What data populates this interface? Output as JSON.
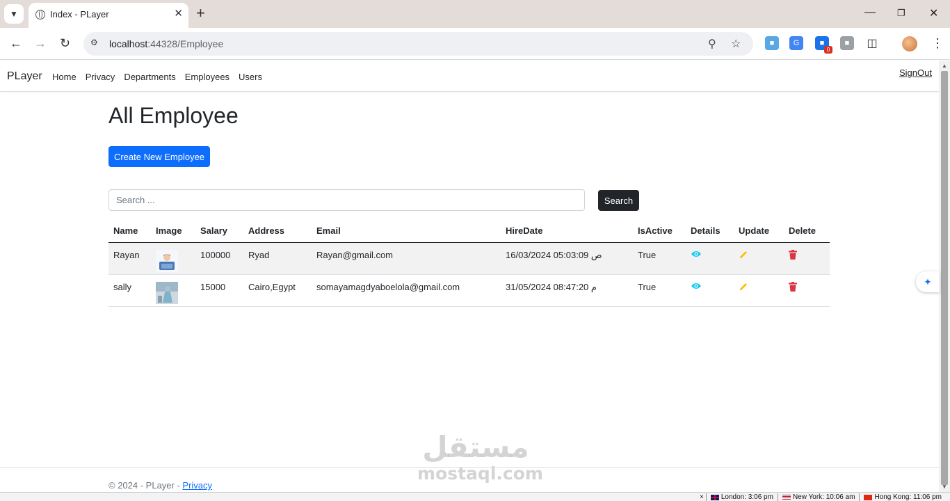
{
  "browser": {
    "tab_title": "Index - PLayer",
    "url_host": "localhost",
    "url_path": ":44328/Employee",
    "extension_badge": "0"
  },
  "navbar": {
    "brand": "PLayer",
    "links": [
      "Home",
      "Privacy",
      "Departments",
      "Employees",
      "Users"
    ],
    "signout": "SignOut"
  },
  "page": {
    "title": "All Employee",
    "create_button": "Create New Employee",
    "search_placeholder": "Search ...",
    "search_button": "Search"
  },
  "table": {
    "headers": [
      "Name",
      "Image",
      "Salary",
      "Address",
      "Email",
      "HireDate",
      "IsActive",
      "Details",
      "Update",
      "Delete"
    ],
    "rows": [
      {
        "name": "Rayan",
        "salary": "100000",
        "address": "Ryad",
        "email": "Rayan@gmail.com",
        "hire_date": "16/03/2024 05:03:09 ص",
        "is_active": "True"
      },
      {
        "name": "sally",
        "salary": "15000",
        "address": "Cairo,Egypt",
        "email": "somayamagdyaboelola@gmail.com",
        "hire_date": "31/05/2024 08:47:20 م",
        "is_active": "True"
      }
    ]
  },
  "footer": {
    "text": "© 2024 - PLayer - ",
    "link": "Privacy"
  },
  "watermark": {
    "arabic": "مستقل",
    "latin": "mostaql.com"
  },
  "statusbar": {
    "clocks": [
      {
        "label": "London: 3:06 pm"
      },
      {
        "label": "New York: 10:06 am"
      },
      {
        "label": "Hong Kong: 11:06 pm"
      }
    ]
  },
  "colors": {
    "primary": "#0d6efd",
    "dark": "#212529",
    "details_icon": "#0dcaf0",
    "update_icon": "#ffc107",
    "delete_icon": "#dc3545"
  }
}
